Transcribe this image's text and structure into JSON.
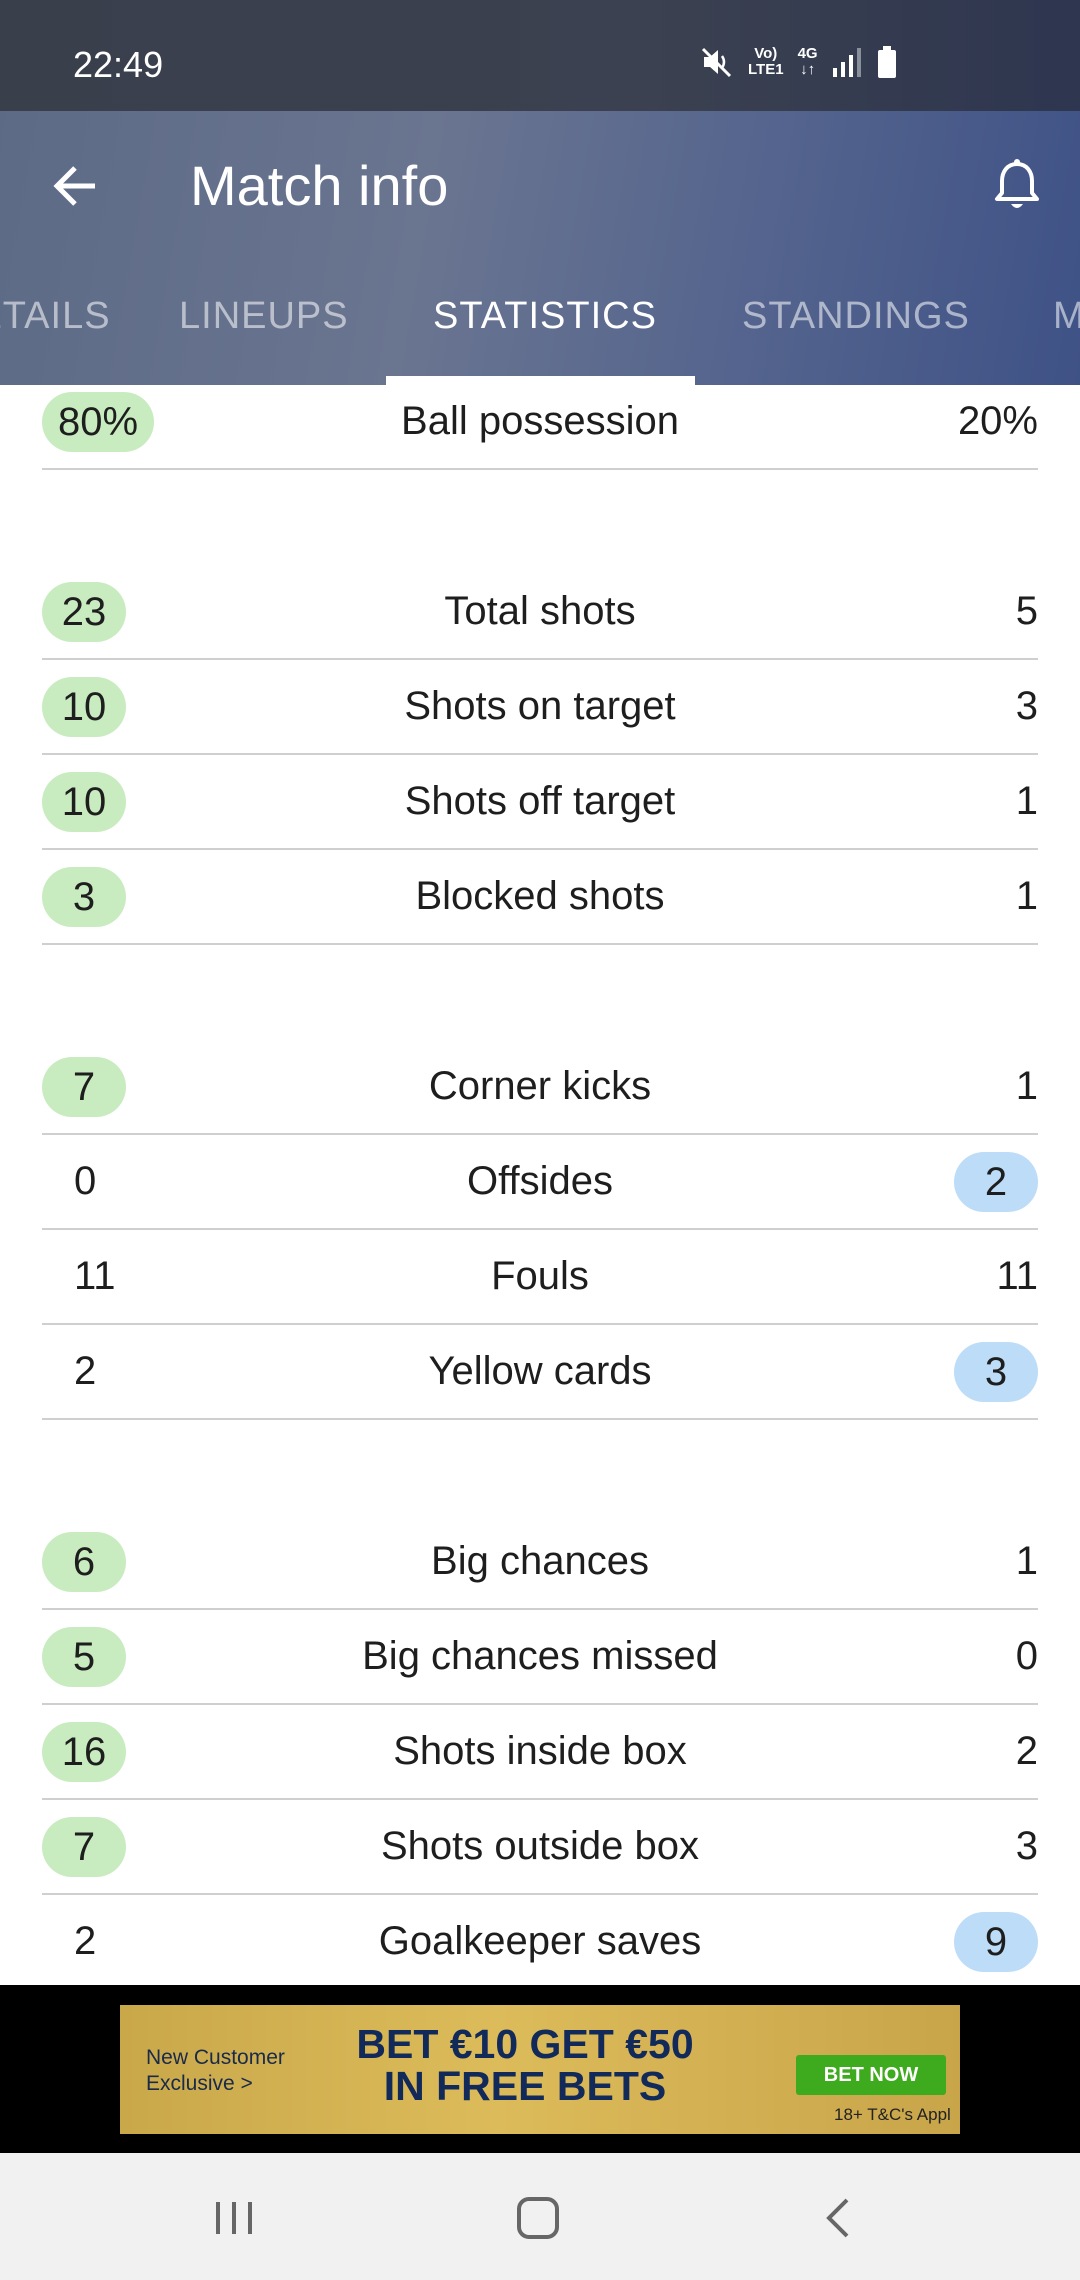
{
  "status_bar": {
    "time": "22:49",
    "network_top": "Vo)",
    "network_bottom": "LTE1",
    "network_type": "4G"
  },
  "toolbar": {
    "title": "Match info",
    "back_icon": "arrow-left-icon",
    "bell_icon": "bell-icon"
  },
  "tabs": [
    {
      "label": "DETAILS"
    },
    {
      "label": "LINEUPS"
    },
    {
      "label": "STATISTICS",
      "active": true
    },
    {
      "label": "STANDINGS"
    },
    {
      "label": "MATCHES"
    }
  ],
  "stats": [
    {
      "label": "Ball possession",
      "home": "80%",
      "away": "20%",
      "highlight": "home"
    },
    {
      "label": "Total shots",
      "home": "23",
      "away": "5",
      "highlight": "home"
    },
    {
      "label": "Shots on target",
      "home": "10",
      "away": "3",
      "highlight": "home"
    },
    {
      "label": "Shots off target",
      "home": "10",
      "away": "1",
      "highlight": "home"
    },
    {
      "label": "Blocked shots",
      "home": "3",
      "away": "1",
      "highlight": "home"
    },
    {
      "label": "Corner kicks",
      "home": "7",
      "away": "1",
      "highlight": "home"
    },
    {
      "label": "Offsides",
      "home": "0",
      "away": "2",
      "highlight": "away"
    },
    {
      "label": "Fouls",
      "home": "11",
      "away": "11",
      "highlight": "none"
    },
    {
      "label": "Yellow cards",
      "home": "2",
      "away": "3",
      "highlight": "away"
    },
    {
      "label": "Big chances",
      "home": "6",
      "away": "1",
      "highlight": "home"
    },
    {
      "label": "Big chances missed",
      "home": "5",
      "away": "0",
      "highlight": "home"
    },
    {
      "label": "Shots inside box",
      "home": "16",
      "away": "2",
      "highlight": "home"
    },
    {
      "label": "Shots outside box",
      "home": "7",
      "away": "3",
      "highlight": "home"
    },
    {
      "label": "Goalkeeper saves",
      "home": "2",
      "away": "9",
      "highlight": "away"
    }
  ],
  "colors": {
    "home_highlight": "#c8ecc0",
    "away_highlight": "#bcdcf7",
    "header": "#5c6a86"
  },
  "ad": {
    "subtitle": "New Customer Exclusive >",
    "headline": "BET €10 GET €50 IN FREE BETS",
    "cta": "BET NOW",
    "terms": "18+ T&C's Appl"
  },
  "navbar": {
    "recents_icon": "recents-icon",
    "home_icon": "home-icon",
    "back_icon": "back-chevron-icon"
  }
}
